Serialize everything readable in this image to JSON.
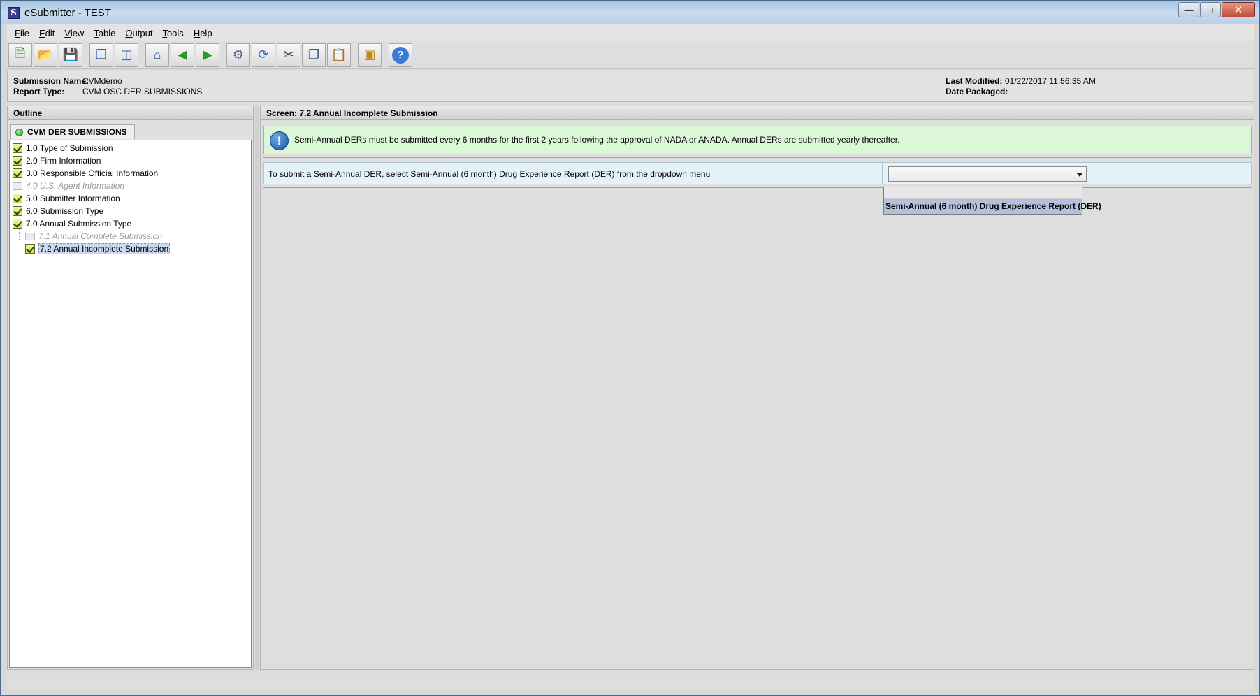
{
  "window": {
    "title": "eSubmitter - TEST",
    "icon_letter": "S"
  },
  "menu": [
    {
      "label": "File",
      "key": "F",
      "rest": "ile"
    },
    {
      "label": "Edit",
      "key": "E",
      "rest": "dit"
    },
    {
      "label": "View",
      "key": "V",
      "rest": "iew"
    },
    {
      "label": "Table",
      "key": "T",
      "rest": "able"
    },
    {
      "label": "Output",
      "key": "O",
      "rest": "utput"
    },
    {
      "label": "Tools",
      "key": "T",
      "rest": "ools"
    },
    {
      "label": "Help",
      "key": "H",
      "rest": "elp"
    }
  ],
  "info": {
    "submission_name_label": "Submission Name:",
    "submission_name": "CVMdemo",
    "report_type_label": "Report Type:",
    "report_type": "CVM OSC DER SUBMISSIONS",
    "last_modified_label": "Last Modified:",
    "last_modified": "01/22/2017 11:56:35 AM",
    "date_packaged_label": "Date Packaged:"
  },
  "outline": {
    "header": "Outline",
    "tab": "CVM DER SUBMISSIONS",
    "items": [
      {
        "label": "1.0 Type of Submission",
        "state": "checked",
        "indent": 0
      },
      {
        "label": "2.0 Firm Information",
        "state": "checked",
        "indent": 0
      },
      {
        "label": "3.0 Responsible Official Information",
        "state": "checked",
        "indent": 0
      },
      {
        "label": "4.0 U.S. Agent Information",
        "state": "disabled",
        "indent": 0
      },
      {
        "label": "5.0 Submitter Information",
        "state": "checked",
        "indent": 0
      },
      {
        "label": "6.0 Submission Type",
        "state": "checked",
        "indent": 0
      },
      {
        "label": "7.0 Annual Submission Type",
        "state": "checked",
        "indent": 0
      },
      {
        "label": "7.1 Annual Complete Submission",
        "state": "disabled",
        "indent": 1
      },
      {
        "label": "7.2 Annual Incomplete Submission",
        "state": "selected",
        "indent": 1
      }
    ]
  },
  "screen": {
    "header": "Screen: 7.2 Annual Incomplete Submission",
    "notice": "Semi-Annual DERs must be submitted every 6 months for the first 2 years following the approval of NADA or ANADA. Annual DERs are submitted yearly thereafter.",
    "question": "To submit a Semi-Annual DER, select Semi-Annual (6 month) Drug Experience Report (DER) from the dropdown menu",
    "select_value": "",
    "dropdown_option": "Semi-Annual (6 month) Drug Experience Report (DER)"
  }
}
